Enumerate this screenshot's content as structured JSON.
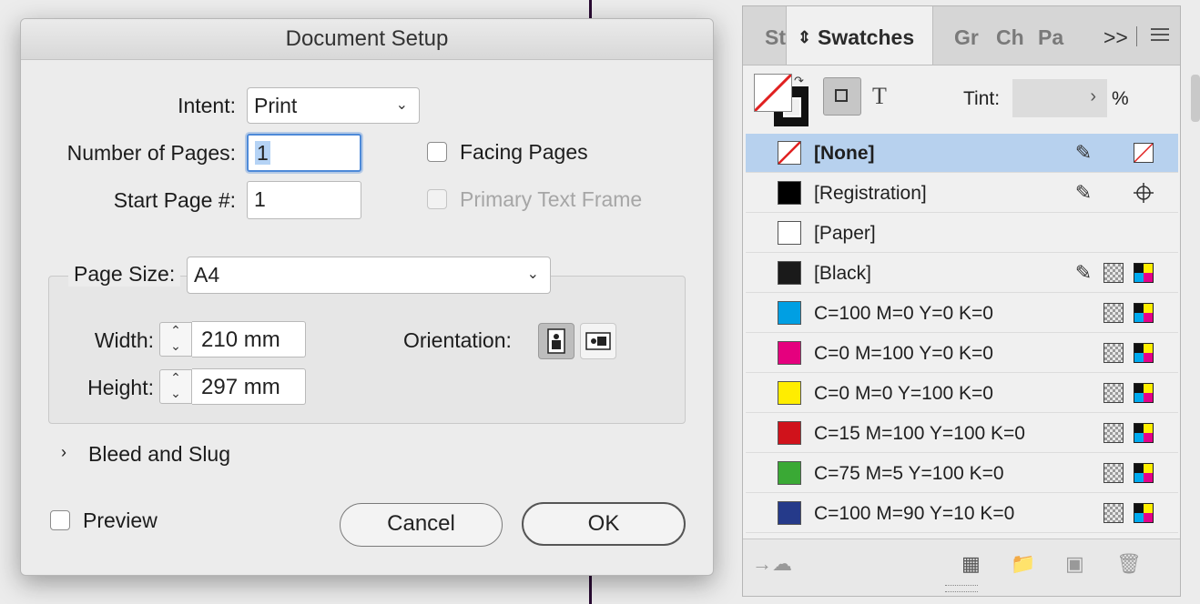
{
  "dialog": {
    "title": "Document Setup",
    "intent_label": "Intent:",
    "intent_value": "Print",
    "num_pages_label": "Number of Pages:",
    "num_pages_value": "1",
    "start_page_label": "Start Page #:",
    "start_page_value": "1",
    "facing_pages_label": "Facing Pages",
    "facing_pages_checked": false,
    "primary_text_frame_label": "Primary Text Frame",
    "primary_text_frame_checked": false,
    "page_size_label": "Page Size:",
    "page_size_value": "A4",
    "width_label": "Width:",
    "width_value": "210 mm",
    "height_label": "Height:",
    "height_value": "297 mm",
    "orientation_label": "Orientation:",
    "orientation_selected": "portrait",
    "bleed_slug_label": "Bleed and Slug",
    "preview_label": "Preview",
    "preview_checked": false,
    "cancel_label": "Cancel",
    "ok_label": "OK"
  },
  "panel": {
    "tabs": [
      {
        "label": "St"
      },
      {
        "label": "Swatches"
      },
      {
        "label": "Gr"
      },
      {
        "label": "Ch"
      },
      {
        "label": "Pa"
      }
    ],
    "active_tab": "Swatches",
    "overflow_label": ">>",
    "tint_label": "Tint:",
    "tint_value": "",
    "tint_unit": "%",
    "text_mode_glyph": "T",
    "swatches": [
      {
        "name": "[None]",
        "color": "none",
        "bold": true,
        "selected": true,
        "locked": true,
        "icon": "none"
      },
      {
        "name": "[Registration]",
        "color": "#000000",
        "bold": false,
        "selected": false,
        "locked": true,
        "icon": "registration"
      },
      {
        "name": "[Paper]",
        "color": "#ffffff",
        "bold": false,
        "selected": false,
        "locked": false,
        "icon": ""
      },
      {
        "name": "[Black]",
        "color": "#1a1a1a",
        "bold": false,
        "selected": false,
        "locked": true,
        "icon": "cmyk"
      },
      {
        "name": "C=100 M=0 Y=0 K=0",
        "color": "#009fe3",
        "bold": false,
        "selected": false,
        "locked": false,
        "icon": "cmyk"
      },
      {
        "name": "C=0 M=100 Y=0 K=0",
        "color": "#e5007e",
        "bold": false,
        "selected": false,
        "locked": false,
        "icon": "cmyk"
      },
      {
        "name": "C=0 M=0 Y=100 K=0",
        "color": "#ffed00",
        "bold": false,
        "selected": false,
        "locked": false,
        "icon": "cmyk"
      },
      {
        "name": "C=15 M=100 Y=100 K=0",
        "color": "#d0121b",
        "bold": false,
        "selected": false,
        "locked": false,
        "icon": "cmyk"
      },
      {
        "name": "C=75 M=5 Y=100 K=0",
        "color": "#3aa935",
        "bold": false,
        "selected": false,
        "locked": false,
        "icon": "cmyk"
      },
      {
        "name": "C=100 M=90 Y=10 K=0",
        "color": "#253a8a",
        "bold": false,
        "selected": false,
        "locked": false,
        "icon": "cmyk"
      }
    ]
  }
}
